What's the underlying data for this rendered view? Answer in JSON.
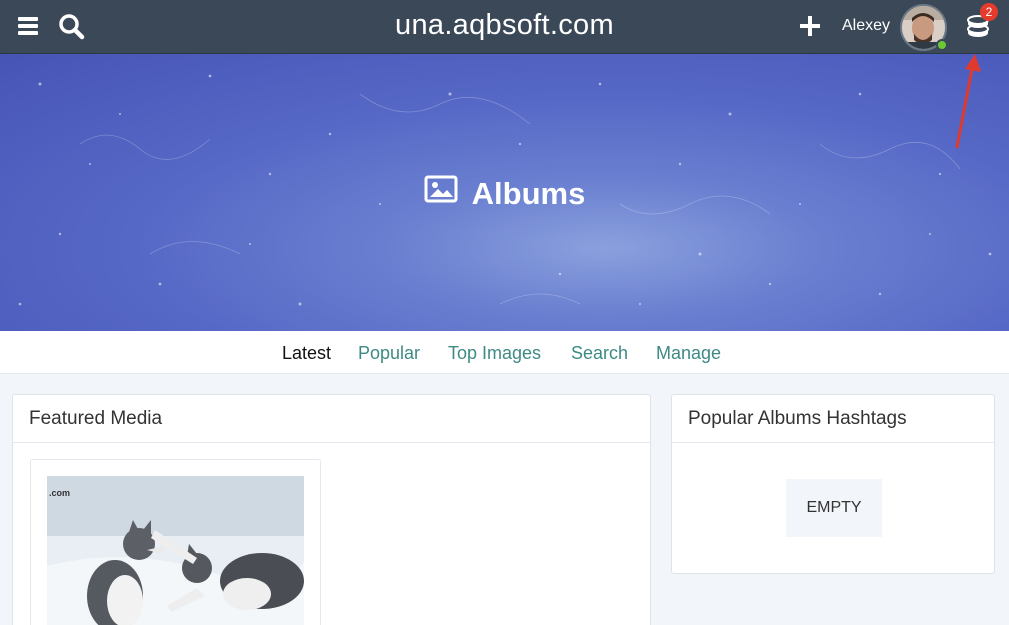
{
  "header": {
    "site_title": "una.aqbsoft.com",
    "username": "Alexey",
    "notification_count": "2",
    "icons": [
      "menu-icon",
      "search-icon",
      "plus-icon",
      "avatar",
      "coins-icon"
    ]
  },
  "cover": {
    "title": "Albums",
    "icon": "image-icon"
  },
  "submenu": {
    "items": [
      {
        "label": "Latest",
        "active": true
      },
      {
        "label": "Popular",
        "active": false
      },
      {
        "label": "Top Images",
        "active": false
      },
      {
        "label": "Search",
        "active": false
      },
      {
        "label": "Manage",
        "active": false
      }
    ]
  },
  "featured": {
    "title": "Featured Media"
  },
  "hashtags": {
    "title": "Popular Albums Hashtags",
    "empty_label": "EMPTY"
  },
  "colors": {
    "topbar": "#3a4858",
    "link": "#3e8a84",
    "badge": "#e53b2c",
    "online": "#6cc936",
    "arrow": "#e03a2e"
  }
}
